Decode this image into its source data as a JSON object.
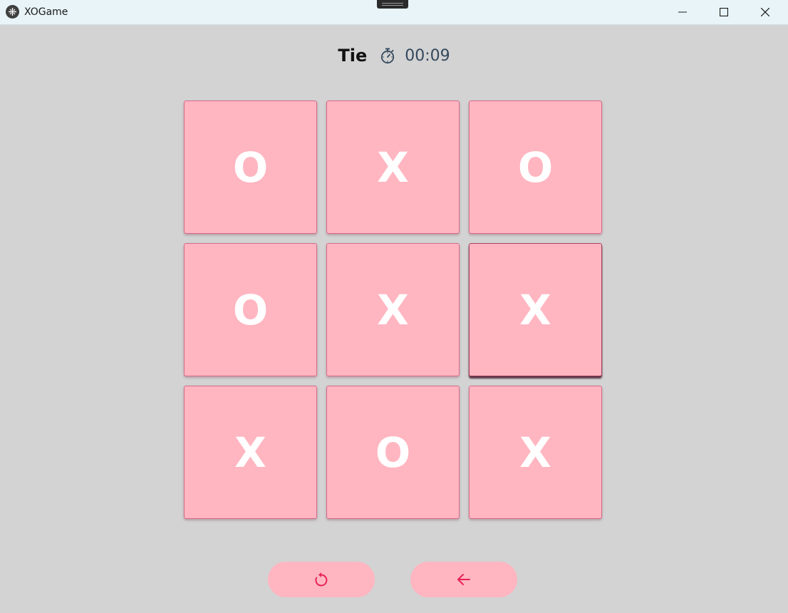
{
  "window": {
    "title": "XOGame",
    "controls": [
      "minimize-icon",
      "maximize-icon",
      "close-icon"
    ]
  },
  "status": {
    "text": "Tie",
    "timer_icon": "stopwatch-icon",
    "time": "00:09"
  },
  "board": {
    "cells": [
      "O",
      "X",
      "O",
      "O",
      "X",
      "X",
      "X",
      "O",
      "X"
    ],
    "focused_cell": 5
  },
  "actions": {
    "restart_icon": "restart-icon",
    "back_icon": "arrow-left-icon"
  },
  "colors": {
    "cell_background": "#ffb6c1",
    "cell_border": "#d66b8a",
    "mark": "#ffffff",
    "accent_icon": "#e8225a",
    "background": "#d3d3d3",
    "titlebar": "#e8f4f8"
  }
}
